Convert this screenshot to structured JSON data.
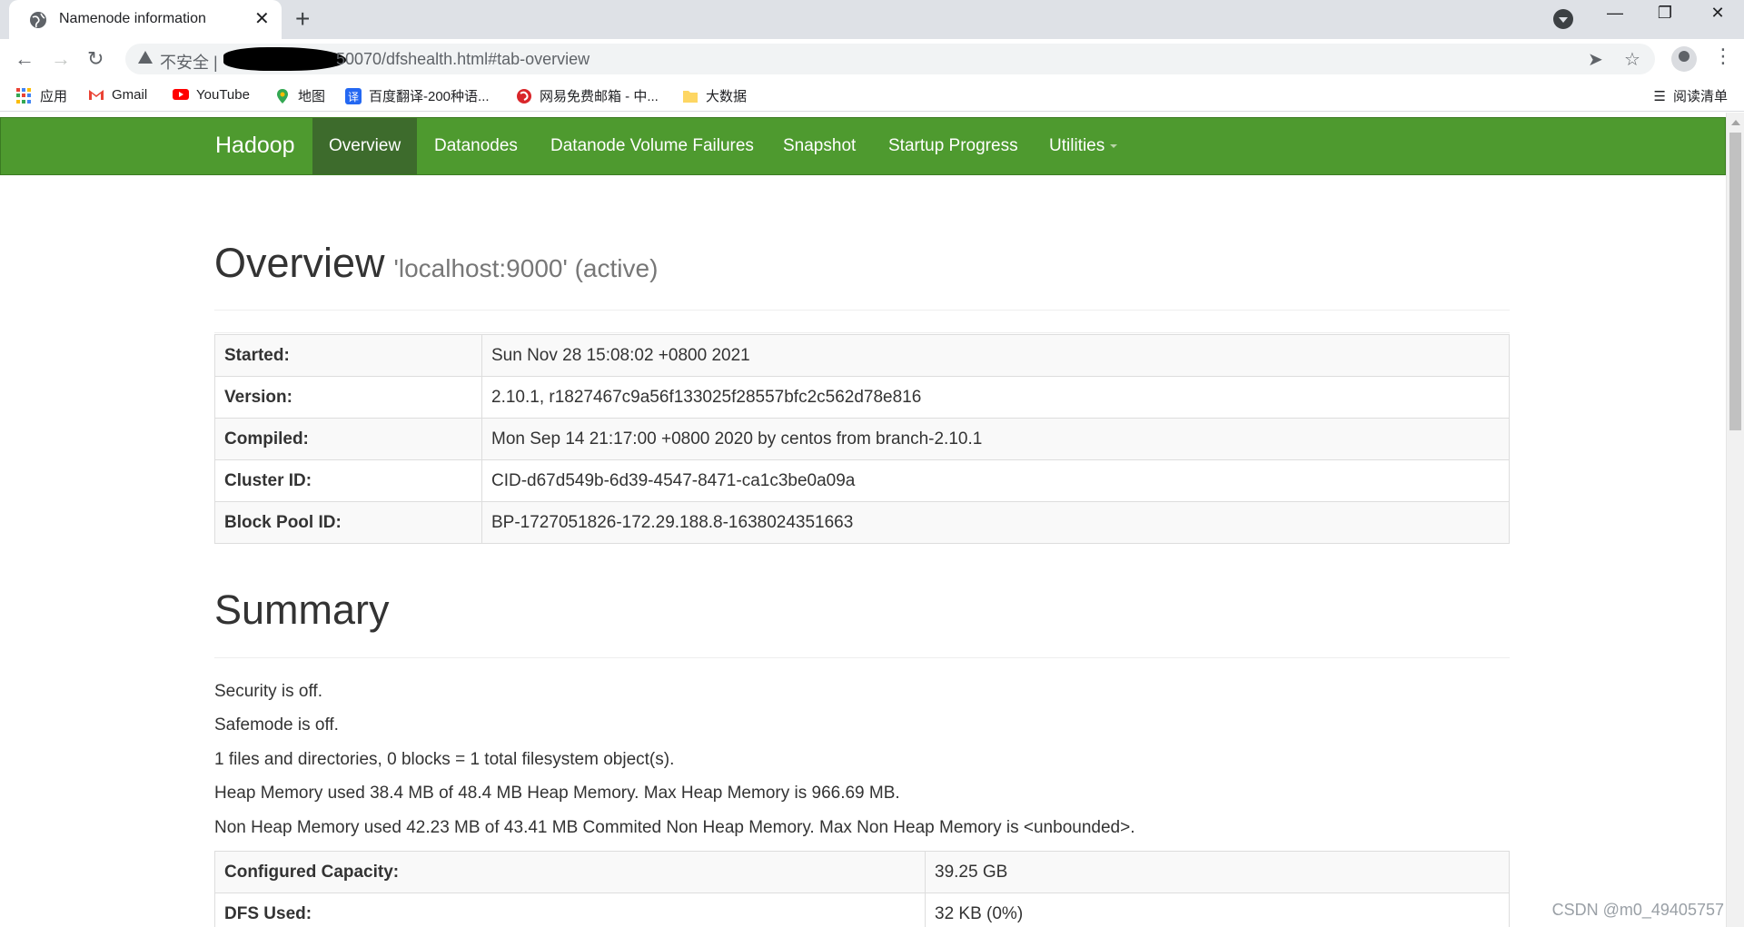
{
  "browser": {
    "tab_title": "Namenode information",
    "tab_close": "✕",
    "new_tab": "+",
    "security_label": "不安全 |",
    "url": "50070/dfshealth.html#tab-overview",
    "window_controls": {
      "minimize": "—",
      "restore": "❐",
      "close": "✕"
    },
    "bookmarks": [
      {
        "label": "应用",
        "icon": "apps-icon"
      },
      {
        "label": "Gmail",
        "icon": "gmail-icon"
      },
      {
        "label": "YouTube",
        "icon": "youtube-icon"
      },
      {
        "label": "地图",
        "icon": "maps-icon"
      },
      {
        "label": "百度翻译-200种语...",
        "icon": "translate-icon"
      },
      {
        "label": "网易免费邮箱 - 中...",
        "icon": "netease-mail-icon"
      },
      {
        "label": "大数据",
        "icon": "folder-icon"
      }
    ],
    "reading_list": "阅读清单"
  },
  "navbar": {
    "brand": "Hadoop",
    "items": [
      {
        "label": "Overview",
        "active": true
      },
      {
        "label": "Datanodes",
        "active": false
      },
      {
        "label": "Datanode Volume Failures",
        "active": false
      },
      {
        "label": "Snapshot",
        "active": false
      },
      {
        "label": "Startup Progress",
        "active": false
      },
      {
        "label": "Utilities",
        "active": false,
        "dropdown": true
      }
    ],
    "colors": {
      "bar": "#4e9a2f",
      "active": "#3d6b2c"
    }
  },
  "overview": {
    "title": "Overview",
    "subtitle": "'localhost:9000' (active)",
    "rows": [
      {
        "key": "Started:",
        "value": "Sun Nov 28 15:08:02 +0800 2021"
      },
      {
        "key": "Version:",
        "value": "2.10.1, r1827467c9a56f133025f28557bfc2c562d78e816"
      },
      {
        "key": "Compiled:",
        "value": "Mon Sep 14 21:17:00 +0800 2020 by centos from branch-2.10.1"
      },
      {
        "key": "Cluster ID:",
        "value": "CID-d67d549b-6d39-4547-8471-ca1c3be0a09a"
      },
      {
        "key": "Block Pool ID:",
        "value": "BP-1727051826-172.29.188.8-1638024351663"
      }
    ]
  },
  "summary": {
    "title": "Summary",
    "lines": [
      "Security is off.",
      "Safemode is off.",
      "1 files and directories, 0 blocks = 1 total filesystem object(s).",
      "Heap Memory used 38.4 MB of 48.4 MB Heap Memory. Max Heap Memory is 966.69 MB.",
      "Non Heap Memory used 42.23 MB of 43.41 MB Commited Non Heap Memory. Max Non Heap Memory is <unbounded>."
    ],
    "rows": [
      {
        "key": "Configured Capacity:",
        "value": "39.25 GB"
      },
      {
        "key": "DFS Used:",
        "value": "32 KB (0%)"
      }
    ]
  },
  "watermark": "CSDN @m0_49405757"
}
